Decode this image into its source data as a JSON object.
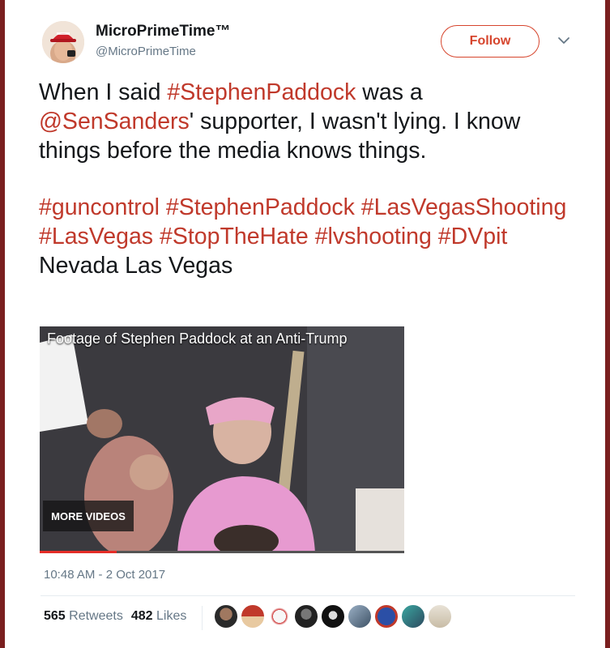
{
  "user": {
    "display_name": "MicroPrimeTime™",
    "handle": "@MicroPrimeTime",
    "avatar_icon": "user-avatar-red-cap"
  },
  "header": {
    "follow_label": "Follow",
    "menu_icon": "chevron-down-icon"
  },
  "tweet": {
    "p1": {
      "t1": "When I said ",
      "h1": "#StephenPaddock",
      "t2": " was a ",
      "m1": "@SenSanders",
      "t3": "' supporter, I wasn't lying. I know things before the media knows things."
    },
    "p2": {
      "h1": "#guncontrol",
      "h2": "#StephenPaddock",
      "h3": "#LasVegasShooting",
      "h4": "#LasVegas",
      "h5": "#StopTheHate",
      "h6": "#lvshooting",
      "h7": "#DVpit",
      "t1": "Nevada Las Vegas"
    }
  },
  "video": {
    "title": "Footage of Stephen Paddock at an Anti-Trump",
    "more_videos_label": "MORE VIDEOS",
    "progress": 0.21
  },
  "timestamp": "10:48 AM - 2 Oct 2017",
  "stats": {
    "retweets_count": "565",
    "retweets_label": "Retweets",
    "likes_count": "482",
    "likes_label": "Likes"
  },
  "likers": [
    "liker-avatar",
    "liker-avatar",
    "liker-avatar",
    "liker-avatar",
    "liker-avatar",
    "liker-avatar",
    "liker-avatar",
    "liker-avatar",
    "liker-avatar"
  ],
  "colors": {
    "accent": "#c0392b",
    "follow_border": "#d6452d",
    "secondary_text": "#657786"
  }
}
